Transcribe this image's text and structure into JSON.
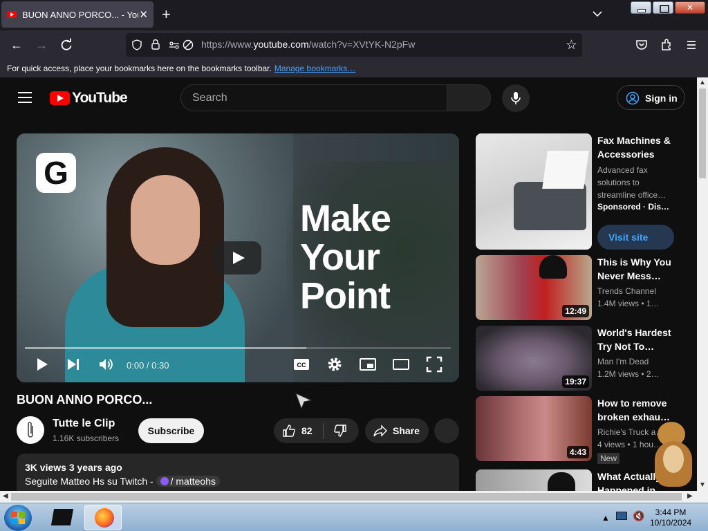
{
  "browser": {
    "tab_title": "BUON ANNO PORCO... - YouTube",
    "url_prefix": "https://www.",
    "url_host": "youtube.com",
    "url_path": "/watch?v=XVtYK-N2pFw",
    "bookmarks_hint": "For quick access, place your bookmarks here on the bookmarks toolbar.",
    "manage_bookmarks": "Manage bookmarks…"
  },
  "youtube": {
    "logo_text": "YouTube",
    "search_placeholder": "Search",
    "sign_in": "Sign in"
  },
  "player": {
    "headline": "Make Your Point",
    "time": "0:00 / 0:30",
    "buffered_fraction": 0.66
  },
  "video": {
    "title": "BUON ANNO PORCO...",
    "channel": "Tutte le Clip",
    "subscribers": "1.16K subscribers",
    "subscribe": "Subscribe",
    "likes": "82",
    "share": "Share",
    "meta": "3K views  3 years ago",
    "description_prefix": "Seguite Matteo Hs su Twitch - ",
    "twitch_handle": "/ matteohs"
  },
  "sidebar": [
    {
      "title": "Fax Machines & Accessories",
      "line1": "Advanced fax solutions to streamline office…",
      "line2": "Sponsored · Dis…",
      "cta": "Visit site"
    },
    {
      "title": "This is Why You Never Mess…",
      "channel": "Trends Channel",
      "stats": "1.4M views  • 1…",
      "duration": "12:49"
    },
    {
      "title": "World's Hardest Try Not To…",
      "channel": "Man I'm Dead",
      "stats": "1.2M views  • 2…",
      "duration": "19:37"
    },
    {
      "title": "How to remove broken exhau…",
      "channel": "Richie's Truck a…",
      "stats": "4 views  • 1 hou…",
      "badge": "New",
      "duration": "4:43"
    },
    {
      "title": "What Actually Happened in…"
    }
  ],
  "taskbar": {
    "time": "3:44 PM",
    "date": "10/10/2024"
  }
}
